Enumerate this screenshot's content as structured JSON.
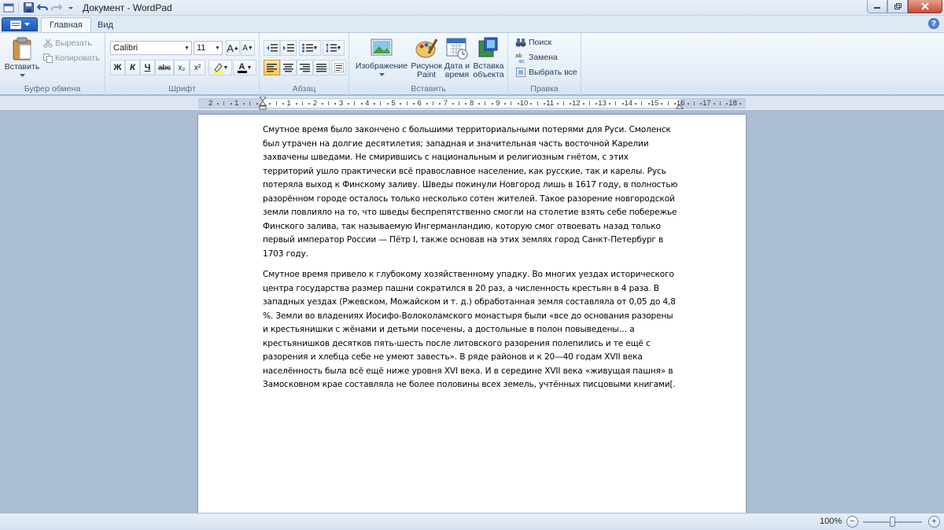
{
  "window": {
    "title": "Документ - WordPad"
  },
  "tabs": [
    {
      "label": "Главная"
    },
    {
      "label": "Вид"
    }
  ],
  "clipboard": {
    "paste": "Вставить",
    "cut": "Вырезать",
    "copy": "Копировать",
    "label": "Буфер обмена"
  },
  "font": {
    "name": "Calibri",
    "size": "11",
    "bold": "Ж",
    "italic": "К",
    "underline": "Ч",
    "strike": "abc",
    "sub": "x₂",
    "sup": "x²",
    "color_letter": "A",
    "grow": "A",
    "shrink": "A",
    "label": "Шрифт"
  },
  "paragraph": {
    "label": "Абзац"
  },
  "insert": {
    "image": "Изображение",
    "paint_1": "Рисунок",
    "paint_2": "Paint",
    "datetime_1": "Дата и",
    "datetime_2": "время",
    "object_1": "Вставка",
    "object_2": "объекта",
    "label": "Вставить"
  },
  "editing": {
    "find": "Поиск",
    "replace": "Замена",
    "select_all": "Выбрать все",
    "label": "Правка"
  },
  "ruler": {
    "labels": [
      "2",
      "1",
      "",
      "1",
      "2",
      "3",
      "4",
      "5",
      "6",
      "7",
      "8",
      "9",
      "10",
      "11",
      "12",
      "13",
      "14",
      "15",
      "16",
      "17",
      "18"
    ]
  },
  "document": {
    "para1": [
      "Смутное время было закончено с большими территориальными потерями для Руси. Смоленск",
      "был утрачен на долгие десятилетия; западная и значительная часть восточной Карелии",
      "захвачены шведами. Не смирившись с национальным и религиозным гнётом, с этих",
      "территорий ушло практически всё православное население, как русские, так и карелы. Русь",
      "потеряла выход к Финскому заливу. Шведы покинули Новгород лишь в 1617 году, в полностью",
      "разорённом городе осталось только несколько сотен жителей. Такое разорение новгородской",
      "земли повлияло на то, что шведы беспрепятственно смогли на столетие взять себе побережье",
      "Финского залива, так называемую Ингерманландию, которую смог отвоевать назад только",
      "первый император России — Пётр I, также основав на этих землях город Санкт-Петербург в",
      "1703 году."
    ],
    "para2": [
      "Смутное время привело к глубокому хозяйственному упадку. Во многих уездах исторического",
      "центра государства размер пашни сократился в 20 раз, а численность крестьян в 4 раза. В",
      "западных уездах (Ржевском, Можайском и т. д.) обработанная земля составляла от 0,05 до 4,8",
      "%. Земли во владениях Иосифо-Волоколамского монастыря были «все до основания разорены",
      "и крестьянишки с жёнами и детьми посечены, а достольные в полон повыведены… а",
      "крестьянишков десятков пять-шесть после литовского разорения полепились и те ещё с",
      "разорения и хлебца себе не умеют завесть». В ряде районов и к 20—40 годам XVII века",
      "населённость была всё ещё ниже уровня XVI века. И в середине XVII века «живущая пашня» в",
      "Замосковном крае составляла не более половины всех земель, учтённых писцовыми книгами[."
    ]
  },
  "status": {
    "zoom": "100%",
    "zoom_level_percent": 100,
    "minus": "−",
    "plus": "+"
  }
}
